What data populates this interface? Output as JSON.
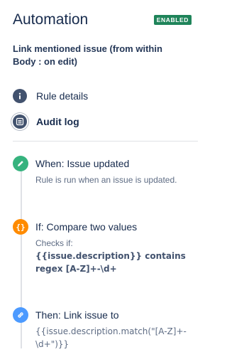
{
  "header": {
    "title": "Automation",
    "status_badge": "ENABLED",
    "badge_color": "#1f845a"
  },
  "rule": {
    "name": "Link mentioned issue (from within Body : on edit)"
  },
  "nav": {
    "items": [
      {
        "label": "Rule details",
        "icon": "info-icon",
        "active": false
      },
      {
        "label": "Audit log",
        "icon": "list-icon",
        "active": true
      }
    ]
  },
  "steps": [
    {
      "title": "When: Issue updated",
      "description": "Rule is run when an issue is updated.",
      "icon": "pencil-icon",
      "color": "#36b37e"
    },
    {
      "title": "If: Compare two values",
      "description_prefix": "Checks if:",
      "description_bold": "{{issue.description}} contains regex [A-Z]+-\\d+",
      "icon": "braces-icon",
      "color": "#ff8b00"
    },
    {
      "title": "Then: Link issue to",
      "description": "{{issue.description.match(\"[A-Z]+-\\d+\")}}",
      "icon": "link-icon",
      "color": "#4c9aff"
    }
  ]
}
